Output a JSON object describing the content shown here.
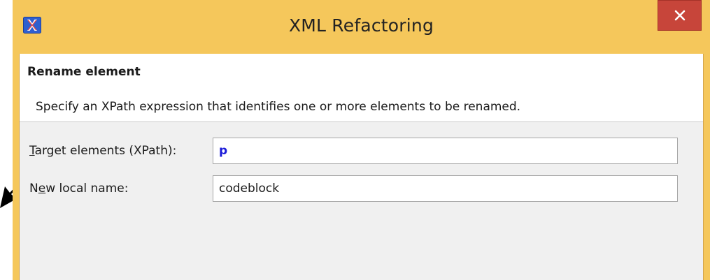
{
  "window": {
    "title": "XML Refactoring",
    "app_icon": "xml-x-icon",
    "close_icon": "close-icon",
    "frame_color": "#f5c75b",
    "close_button_color": "#c7453a"
  },
  "header": {
    "heading": "Rename element",
    "description": "Specify an XPath expression that identifies one or more elements to be renamed."
  },
  "form": {
    "target_label_mnemonic": "T",
    "target_label_rest": "arget elements (XPath):",
    "target_value": "p",
    "newname_label_pre": "N",
    "newname_label_mnemonic": "e",
    "newname_label_rest": "w local name:",
    "newname_value": "codeblock"
  },
  "annotation": {
    "arrow_icon": "pointer-arrow-icon"
  }
}
